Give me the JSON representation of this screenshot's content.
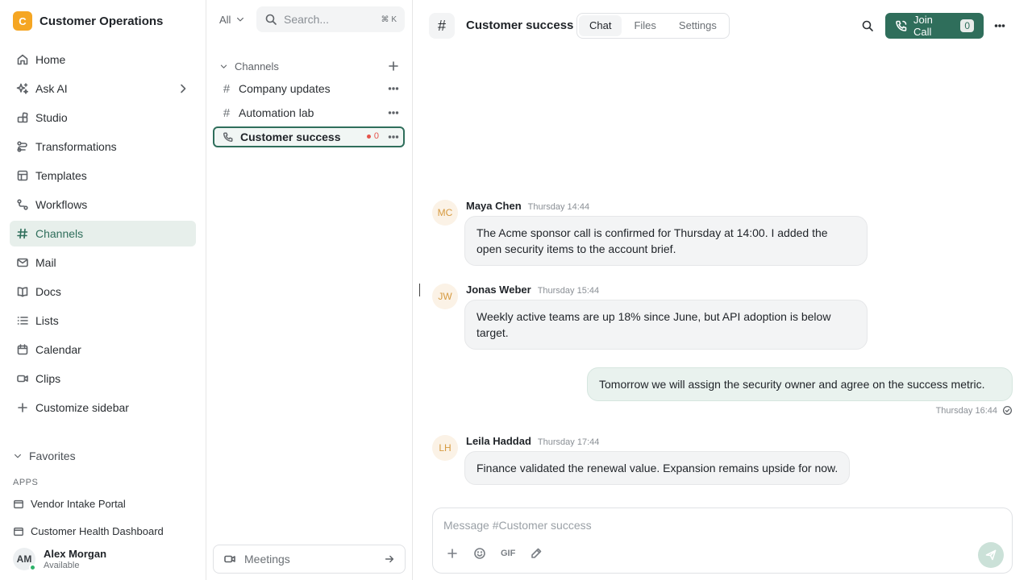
{
  "workspace": {
    "logo_letter": "C",
    "name": "Customer Operations",
    "logo_color": "#f5a623"
  },
  "nav": {
    "items": [
      {
        "label": "Home",
        "icon": "home-icon"
      },
      {
        "label": "Ask AI",
        "icon": "sparkle-icon"
      },
      {
        "label": "Studio",
        "icon": "studio-icon"
      },
      {
        "label": "Transformations",
        "icon": "transform-icon"
      },
      {
        "label": "Templates",
        "icon": "template-icon"
      },
      {
        "label": "Workflows",
        "icon": "workflow-icon"
      },
      {
        "label": "Channels",
        "icon": "hash-icon",
        "active": true
      },
      {
        "label": "Mail",
        "icon": "mail-icon"
      },
      {
        "label": "Docs",
        "icon": "book-icon"
      },
      {
        "label": "Lists",
        "icon": "list-icon"
      },
      {
        "label": "Calendar",
        "icon": "calendar-icon"
      },
      {
        "label": "Clips",
        "icon": "video-icon"
      },
      {
        "label": "Customize sidebar",
        "icon": "plus-icon"
      }
    ]
  },
  "favorites": {
    "label": "Favorites",
    "apps_label": "APPS",
    "apps": [
      "Vendor Intake Portal",
      "Customer Health Dashboard"
    ]
  },
  "user": {
    "initials": "AM",
    "name": "Alex Morgan",
    "status": "Available"
  },
  "channel_list": {
    "filter": "All",
    "search_placeholder": "Search...",
    "search_shortcut": "⌘ K",
    "section_label": "Channels",
    "channels": [
      {
        "name": "Company updates",
        "type": "text"
      },
      {
        "name": "Automation lab",
        "type": "text"
      },
      {
        "name": "Customer success",
        "type": "call",
        "active": true,
        "unread": "0"
      }
    ],
    "meetings_label": "Meetings"
  },
  "header": {
    "title": "Customer success",
    "tabs": [
      "Chat",
      "Files",
      "Settings"
    ],
    "active_tab": "Chat",
    "join_label": "Join Call",
    "join_count": "0",
    "accent": "#2f6e5b"
  },
  "messages": [
    {
      "initials": "MC",
      "author": "Maya Chen",
      "time": "Thursday 14:44",
      "text": "The Acme sponsor call is confirmed for Thursday at 14:00. I added the open security items to the account brief."
    },
    {
      "initials": "JW",
      "author": "Jonas Weber",
      "time": "Thursday 15:44",
      "text": "Weekly active teams are up 18% since June, but API adoption is below target."
    },
    {
      "initials": "LH",
      "author": "Leila Haddad",
      "time": "Thursday 17:44",
      "text": "Finance validated the renewal value. Expansion remains upside for now."
    }
  ],
  "outgoing": {
    "text": "Tomorrow we will assign the security owner and agree on the success metric.",
    "time": "Thursday 16:44"
  },
  "composer": {
    "placeholder": "Message #Customer success",
    "gif_label": "GIF"
  }
}
